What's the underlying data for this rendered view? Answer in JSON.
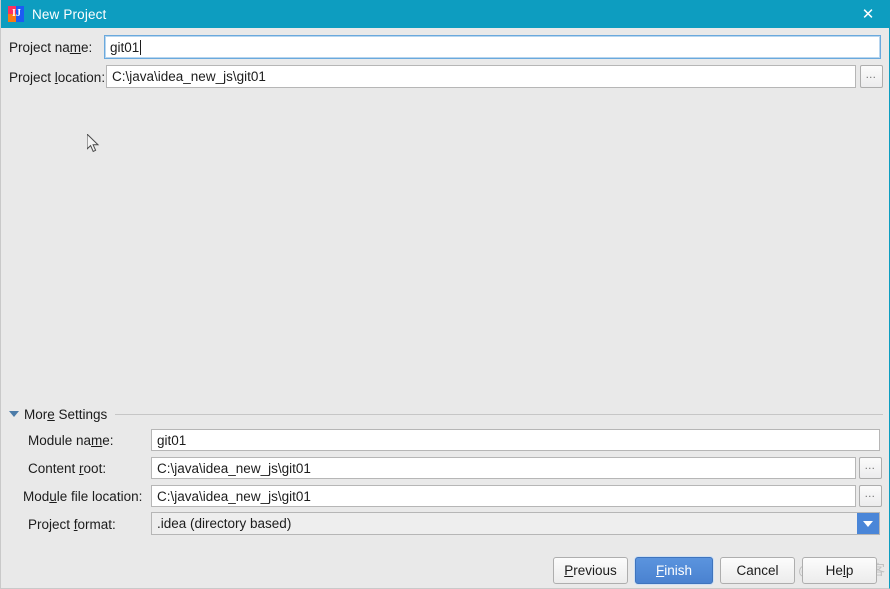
{
  "window": {
    "title": "New Project",
    "icon": "intellij-idea-icon",
    "close_label": "✕",
    "titlebar_color": "#0d9dc0",
    "background_color": "#e9e9e9"
  },
  "top_form": {
    "project_name": {
      "label_before": "Project na",
      "label_mnemonic": "m",
      "label_after": "e:",
      "label_full": "Project name:",
      "value": "git01",
      "focused": true
    },
    "project_location": {
      "label_before": "Project ",
      "label_mnemonic": "l",
      "label_after": "ocation:",
      "label_full": "Project location:",
      "value": "C:\\java\\idea_new_js\\git01",
      "browse_label": "…",
      "browse_name": "browse-project-location-button"
    }
  },
  "more_settings": {
    "label_before": "Mor",
    "label_mnemonic": "e",
    "label_after": " Settings",
    "label_full": "More Settings",
    "expanded": true,
    "fields": [
      {
        "name": "module-name",
        "label_before": "Module na",
        "label_mnemonic": "m",
        "label_after": "e:",
        "label_full": "Module name:",
        "value": "git01",
        "has_browse": false
      },
      {
        "name": "content-root",
        "label_before": "Content ",
        "label_mnemonic": "r",
        "label_after": "oot:",
        "label_full": "Content root:",
        "value": "C:\\java\\idea_new_js\\git01",
        "has_browse": true,
        "browse_label": "…"
      },
      {
        "name": "module-file-location",
        "label_before": "Mod",
        "label_mnemonic": "u",
        "label_after": "le file location:",
        "label_full": "Module file location:",
        "value": "C:\\java\\idea_new_js\\git01",
        "has_browse": true,
        "browse_label": "…"
      }
    ],
    "project_format": {
      "label_before": "Project ",
      "label_mnemonic": "f",
      "label_after": "ormat:",
      "label_full": "Project format:",
      "value": ".idea (directory based)",
      "options": [
        ".idea (directory based)"
      ],
      "arrow_color": "#4a86d8"
    }
  },
  "buttons": {
    "previous": {
      "before": "",
      "mnemonic": "P",
      "after": "revious",
      "full": "Previous",
      "primary": false
    },
    "finish": {
      "before": "",
      "mnemonic": "F",
      "after": "inish",
      "full": "Finish",
      "primary": true
    },
    "cancel": {
      "before": "Cancel",
      "mnemonic": "",
      "after": "",
      "full": "Cancel",
      "primary": false
    },
    "help": {
      "before": "He",
      "mnemonic": "l",
      "after": "p",
      "full": "Help",
      "primary": false
    }
  },
  "watermark": {
    "text": "@ITPUB博客"
  }
}
